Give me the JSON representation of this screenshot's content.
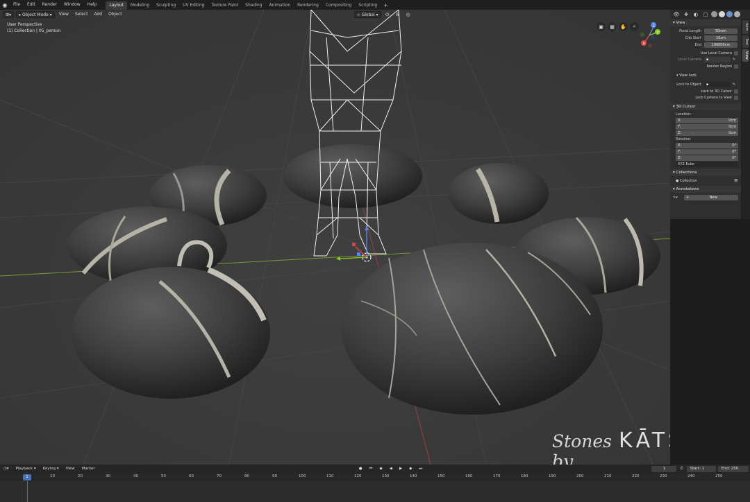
{
  "menu": [
    "File",
    "Edit",
    "Render",
    "Window",
    "Help"
  ],
  "workspaces": [
    "Layout",
    "Modeling",
    "Sculpting",
    "UV Editing",
    "Texture Paint",
    "Shading",
    "Animation",
    "Rendering",
    "Compositing",
    "Scripting"
  ],
  "workspace_add": "+",
  "header3d": {
    "mode": "Object Mode",
    "menus": [
      "View",
      "Select",
      "Add",
      "Object"
    ],
    "orientation": "Global"
  },
  "overlay": {
    "view_name": "User Perspective",
    "collection": "(1) Collection | 05_person"
  },
  "gizmo": {
    "z": "Z",
    "y": "Y",
    "x": "X"
  },
  "brand": {
    "script": "Stones by",
    "mark": "KĀTSU"
  },
  "npanel": {
    "tabs": [
      "Item",
      "Tool",
      "View"
    ],
    "view": {
      "header": "View",
      "focal_length_label": "Focal Length",
      "focal_length": "50mm",
      "clip_start_label": "Clip Start",
      "clip_start": "10cm",
      "clip_end_label": "End",
      "clip_end": "100000cm",
      "use_local_camera": "Use Local Camera",
      "local_camera": "Local Camera",
      "render_region": "Render Region"
    },
    "view_lock": {
      "header": "View Lock",
      "lock_to_object": "Lock to Object",
      "lock_to_cursor": "Lock to 3D Cursor",
      "lock_camera": "Lock Camera to View"
    },
    "cursor": {
      "header": "3D Cursor",
      "location_label": "Location:",
      "location": [
        {
          "axis": "X:",
          "value": "0cm"
        },
        {
          "axis": "Y:",
          "value": "0cm"
        },
        {
          "axis": "Z:",
          "value": "0cm"
        }
      ],
      "rotation_label": "Rotation:",
      "rotation": [
        {
          "axis": "X:",
          "value": "0°"
        },
        {
          "axis": "Y:",
          "value": "0°"
        },
        {
          "axis": "Z:",
          "value": "0°"
        }
      ],
      "rotation_mode": "XYZ Euler"
    },
    "collections": {
      "header": "Collections",
      "item": "Collection"
    },
    "annotations": {
      "header": "Annotations",
      "new_label": "New"
    }
  },
  "timeline": {
    "menus": [
      "Playback",
      "Keying",
      "View",
      "Marker"
    ],
    "current_frame": "1",
    "start_label": "Start:",
    "start": "1",
    "end_label": "End:",
    "end": "250",
    "ruler_frame": "1",
    "ticks": [
      "10",
      "20",
      "30",
      "40",
      "50",
      "60",
      "70",
      "80",
      "90",
      "100",
      "110",
      "120",
      "130",
      "140",
      "150",
      "160",
      "170",
      "180",
      "190",
      "200",
      "210",
      "220",
      "230",
      "240",
      "250"
    ]
  }
}
